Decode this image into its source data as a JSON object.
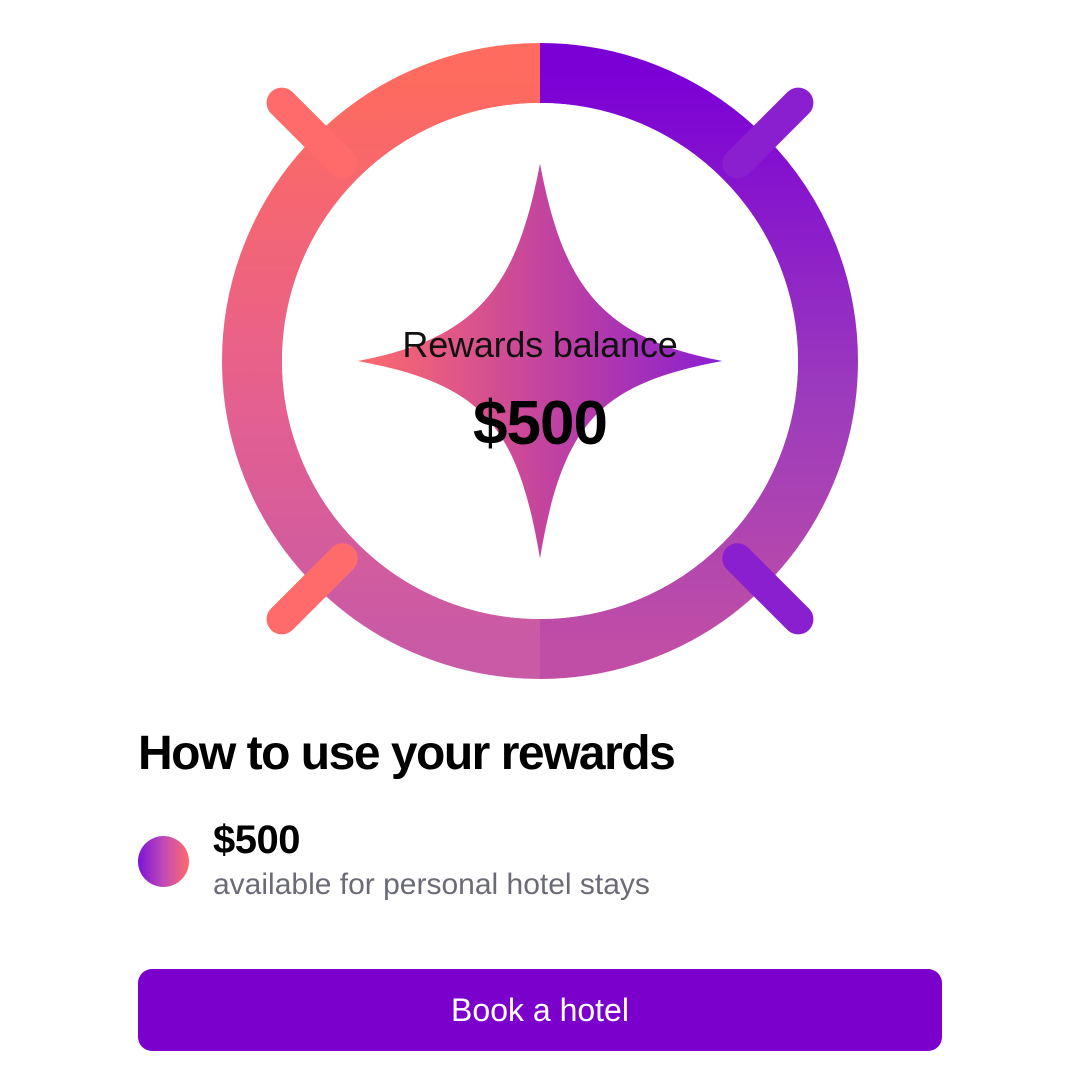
{
  "balance_card": {
    "label": "Rewards balance",
    "amount": "$500",
    "icon": "sparkle-icon",
    "ring_gradient_start": "#ff6b5e",
    "ring_gradient_end": "#7b00d6"
  },
  "rewards_section": {
    "title": "How to use your rewards",
    "items": [
      {
        "amount": "$500",
        "description": "available for personal hotel stays",
        "icon": "gradient-dot-icon"
      }
    ]
  },
  "actions": {
    "book_label": "Book a hotel",
    "button_color": "#7c00cc"
  }
}
